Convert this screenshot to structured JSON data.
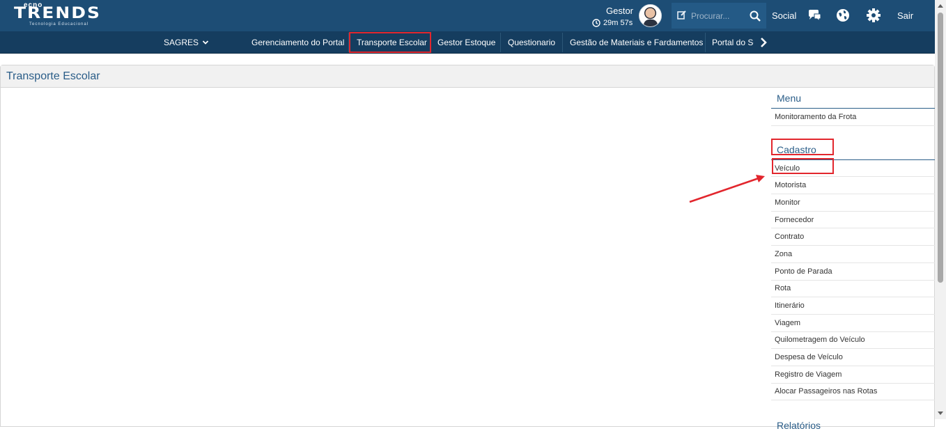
{
  "brand": {
    "tecno": "ecno",
    "word": "TRENDS",
    "tagline": "Tecnologia Educacional"
  },
  "header": {
    "user_name": "Gestor",
    "session_timer": "29m 57s",
    "search_placeholder": "Procurar...",
    "social_label": "Social",
    "logout_label": "Sair"
  },
  "nav": {
    "items": [
      {
        "label": "SAGRES"
      },
      {
        "label": "Gerenciamento do Portal"
      },
      {
        "label": "Transporte Escolar"
      },
      {
        "label": "Gestor Estoque"
      },
      {
        "label": "Questionario"
      },
      {
        "label": "Gestão de Materiais e Fardamentos"
      },
      {
        "label": "Portal do Se"
      }
    ]
  },
  "page": {
    "title": "Transporte Escolar"
  },
  "sidebar": {
    "menu_title": "Menu",
    "menu_items": [
      {
        "label": "Monitoramento da Frota"
      }
    ],
    "cadastro_title": "Cadastro",
    "cadastro_items": [
      {
        "label": "Veículo"
      },
      {
        "label": "Motorista"
      },
      {
        "label": "Monitor"
      },
      {
        "label": "Fornecedor"
      },
      {
        "label": "Contrato"
      },
      {
        "label": "Zona"
      },
      {
        "label": "Ponto de Parada"
      },
      {
        "label": "Rota"
      },
      {
        "label": "Itinerário"
      },
      {
        "label": "Viagem"
      },
      {
        "label": "Quilometragem do Veículo"
      },
      {
        "label": "Despesa de Veículo"
      },
      {
        "label": "Registro de Viagem"
      },
      {
        "label": "Alocar Passageiros nas Rotas"
      }
    ],
    "relatorios_title": "Relatórios"
  },
  "colors": {
    "header_bg": "#1d4d75",
    "nav_bg": "#153d5f",
    "highlight": "#e2262d",
    "accent_text": "#2a5d88"
  },
  "icons": [
    "clock-icon",
    "edit-icon",
    "search-icon",
    "chat-icon",
    "globe-icon",
    "gear-icon",
    "chevron-down-icon",
    "chevron-right-icon",
    "arrow-annotation"
  ]
}
